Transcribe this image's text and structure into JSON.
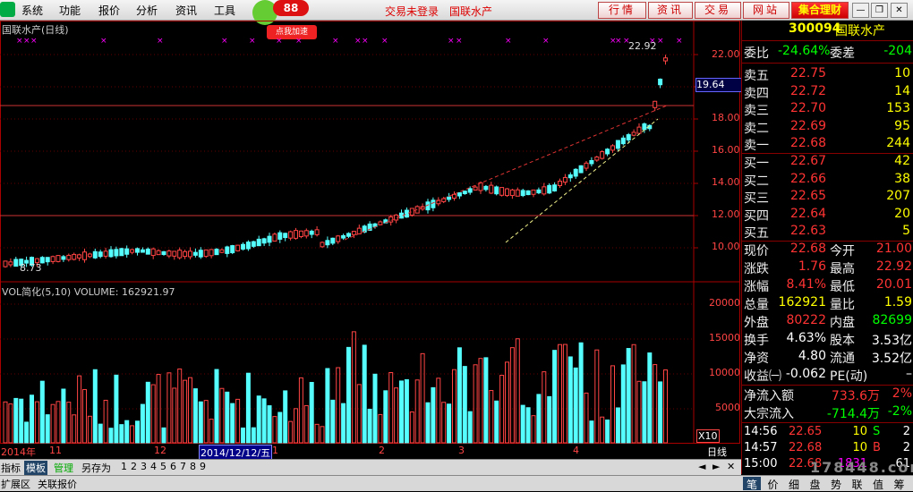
{
  "menubar": {
    "items": [
      "系统",
      "功能",
      "报价",
      "分析",
      "资讯",
      "工具"
    ],
    "badge": "88",
    "promo": "点我加速",
    "status_login": "交易未登录",
    "status_stock": "国联水产",
    "buttons": [
      "行情",
      "资讯",
      "交易",
      "网站"
    ],
    "highlight_button": "集合理财"
  },
  "chart": {
    "title": "国联水产(日线)",
    "price_ticks": [
      "22.00",
      "20.00",
      "18.00",
      "16.00",
      "14.00",
      "12.00",
      "10.00"
    ],
    "current_price_marker": "19.64",
    "max_label": "22.92",
    "min_label": "8.73",
    "vol_title": "VOL简化(5,10)  VOLUME: 162921.97",
    "vol_ticks": [
      "20000",
      "15000",
      "10000",
      "5000"
    ],
    "vol_unit": "X10",
    "x_labels": [
      "2014年",
      "11",
      "12",
      "1",
      "2",
      "3",
      "4"
    ],
    "cursor_date": "2014/12/12/五",
    "period": "日线"
  },
  "chart_data": {
    "type": "candlestick",
    "y_price_range": [
      8.73,
      22.92
    ],
    "y_volume_range": [
      0,
      20000
    ]
  },
  "panel": {
    "code": "300094",
    "name": "国联水产",
    "weibi_label": "委比",
    "weibi": "-24.64%",
    "weicha_label": "委差",
    "weicha": "-204",
    "asks": [
      {
        "label": "卖五",
        "price": "22.75",
        "vol": "10"
      },
      {
        "label": "卖四",
        "price": "22.72",
        "vol": "14"
      },
      {
        "label": "卖三",
        "price": "22.70",
        "vol": "153"
      },
      {
        "label": "卖二",
        "price": "22.69",
        "vol": "95"
      },
      {
        "label": "卖一",
        "price": "22.68",
        "vol": "244"
      }
    ],
    "bids": [
      {
        "label": "买一",
        "price": "22.67",
        "vol": "42"
      },
      {
        "label": "买二",
        "price": "22.66",
        "vol": "38"
      },
      {
        "label": "买三",
        "price": "22.65",
        "vol": "207"
      },
      {
        "label": "买四",
        "price": "22.64",
        "vol": "20"
      },
      {
        "label": "买五",
        "price": "22.63",
        "vol": "5"
      }
    ],
    "stats": [
      {
        "l1": "现价",
        "v1": "22.68",
        "l2": "今开",
        "v2": "21.00"
      },
      {
        "l1": "涨跌",
        "v1": "1.76",
        "l2": "最高",
        "v2": "22.92"
      },
      {
        "l1": "涨幅",
        "v1": "8.41%",
        "l2": "最低",
        "v2": "20.01"
      },
      {
        "l1": "总量",
        "v1": "162921",
        "l2": "量比",
        "v2": "1.59"
      },
      {
        "l1": "外盘",
        "v1": "80222",
        "l2": "内盘",
        "v2": "82699"
      },
      {
        "l1": "换手",
        "v1": "4.63%",
        "l2": "股本",
        "v2": "3.53亿"
      },
      {
        "l1": "净资",
        "v1": "4.80",
        "l2": "流通",
        "v2": "3.52亿"
      },
      {
        "l1": "收益㈠",
        "v1": "-0.062",
        "l2": "PE(动)",
        "v2": "–"
      }
    ],
    "flow": [
      {
        "label": "净流入额",
        "value": "733.6万",
        "pct": "2%"
      },
      {
        "label": "大宗流入",
        "value": "-714.4万",
        "pct": "-2%"
      }
    ],
    "ticks": [
      {
        "time": "14:56",
        "price": "22.65",
        "vol": "10",
        "side": "S",
        "n": "2"
      },
      {
        "time": "14:57",
        "price": "22.68",
        "vol": "10",
        "side": "B",
        "n": "2"
      },
      {
        "time": "15:00",
        "price": "22.68",
        "vol": "1831",
        "side": "",
        "n": "61"
      }
    ]
  },
  "tabbar": {
    "tabs": [
      "指标",
      "模板",
      "管理",
      "另存为"
    ],
    "pages": [
      "1",
      "2",
      "3",
      "4",
      "5",
      "6",
      "7",
      "8",
      "9"
    ]
  },
  "statusbar": {
    "tabs": [
      "扩展区",
      "关联报价"
    ],
    "panel_tabs": [
      "笔",
      "价",
      "细",
      "盘",
      "势",
      "联",
      "值",
      "筹"
    ]
  },
  "watermark": "178448.com"
}
